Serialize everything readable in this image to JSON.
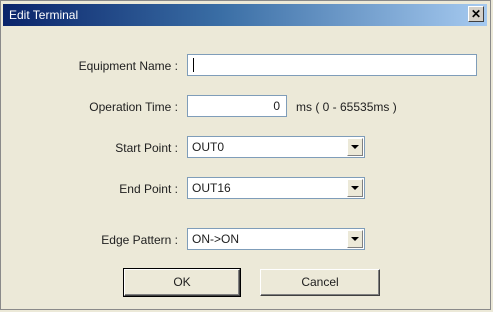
{
  "window": {
    "title": "Edit Terminal",
    "close_glyph": "✕"
  },
  "form": {
    "equipment_name": {
      "label": "Equipment Name :",
      "value": ""
    },
    "operation_time": {
      "label": "Operation Time :",
      "value": "0",
      "unit": "ms ( 0 - 65535ms )"
    },
    "start_point": {
      "label": "Start Point :",
      "value": "OUT0"
    },
    "end_point": {
      "label": "End Point :",
      "value": "OUT16"
    },
    "edge_pattern": {
      "label": "Edge Pattern :",
      "value": "ON->ON"
    }
  },
  "buttons": {
    "ok_label": "OK",
    "cancel_label": "Cancel"
  },
  "icons": {
    "close": "close-icon",
    "dropdown": "chevron-down-icon"
  },
  "colors": {
    "title_start": "#0a246a",
    "title_end": "#a6caf0",
    "dialog_bg": "#ece9d8"
  }
}
